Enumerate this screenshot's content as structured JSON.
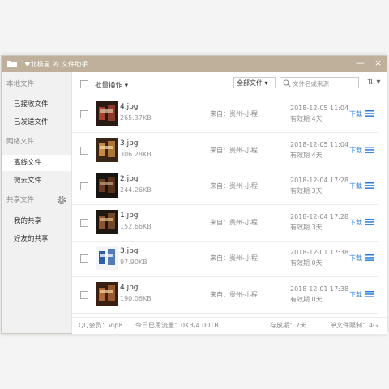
{
  "window": {
    "title": "`♥北极星 的 文件助手",
    "minimize": "—",
    "close": "×"
  },
  "sidebar": {
    "local_header": "本地文件",
    "received": "已接收文件",
    "sent": "已发送文件",
    "network_header": "网络文件",
    "offline": "离线文件",
    "weiyun": "微云文件",
    "shared_header": "共享文件",
    "my_shares": "我的共享",
    "friend_shares": "好友的共享"
  },
  "toolbar": {
    "batch_label": "批量操作 ▾",
    "filter_value": "全部文件 ▾",
    "search_placeholder": "文件名或来源",
    "sort_label": "⇅ ▾"
  },
  "files": [
    {
      "name": "4.jpg",
      "size": "265.37KB",
      "source": "来自：贵州-小程",
      "date": "2018-12-05 11:04",
      "expiry": "有效期 4天",
      "download": "下载"
    },
    {
      "name": "3.jpg",
      "size": "306.28KB",
      "source": "来自：贵州-小程",
      "date": "2018-12-05 11:04",
      "expiry": "有效期 4天",
      "download": "下载"
    },
    {
      "name": "2.jpg",
      "size": "244.26KB",
      "source": "来自：贵州-小程",
      "date": "2018-12-04 17:28",
      "expiry": "有效期 3天",
      "download": "下载"
    },
    {
      "name": "1.jpg",
      "size": "152.66KB",
      "source": "来自：贵州-小程",
      "date": "2018-12-04 17:28",
      "expiry": "有效期 3天",
      "download": "下载"
    },
    {
      "name": "3.jpg",
      "size": "97.90KB",
      "source": "来自：贵州-小程",
      "date": "2018-12-01 17:38",
      "expiry": "有效期 0天",
      "download": "下载"
    },
    {
      "name": "4.jpg",
      "size": "190.06KB",
      "source": "来自：贵州-小程",
      "date": "2018-12-01 17:38",
      "expiry": "有效期 0天",
      "download": "下载"
    }
  ],
  "status": {
    "member": "QQ会员：Vip8",
    "traffic": "今日已用流量：0KB/4.00TB",
    "retention": "存放期：7天",
    "limit": "单文件限制：4G"
  },
  "colors": {
    "titlebar": "#beb09a",
    "link": "#2d7bd8",
    "sidebar_bg": "#f1f1f1"
  },
  "icons": {
    "title": "folder-icon",
    "settings": "gear-icon",
    "search": "search-icon",
    "row_menu": "menu-icon"
  }
}
